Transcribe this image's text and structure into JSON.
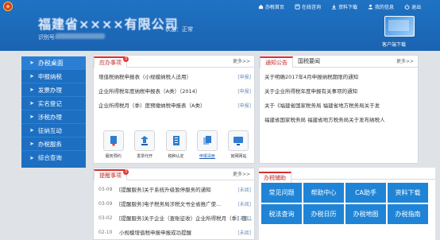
{
  "header": {
    "company_name": "福建省××××有限公司",
    "tax_id_label": "识别号:",
    "status": "状态：正常",
    "nav": [
      {
        "icon": "home-icon",
        "label": "办税首页"
      },
      {
        "icon": "query-icon",
        "label": "在线咨询"
      },
      {
        "icon": "download-icon",
        "label": "资料下载"
      },
      {
        "icon": "user-icon",
        "label": "我的信息"
      },
      {
        "icon": "power-icon",
        "label": "退出"
      }
    ],
    "client_download": "客户端下载"
  },
  "sidebar": {
    "items": [
      {
        "label": "办税桌面"
      },
      {
        "label": "申报纳税"
      },
      {
        "label": "发票办理"
      },
      {
        "label": "实名登记"
      },
      {
        "label": "涉税办理"
      },
      {
        "label": "征纳互动"
      },
      {
        "label": "办税服务"
      },
      {
        "label": "综合查询"
      }
    ]
  },
  "todo": {
    "tab": "应办事项",
    "badge": "3",
    "more": "更多>>",
    "rows": [
      {
        "text": "增值税纳税申报表（小规模纳税人适用）",
        "tag": "[申报]"
      },
      {
        "text": "企业所得税年度纳税申报表（A类）（2014）",
        "tag": "[申报]"
      },
      {
        "text": "企业所得税月（季）度预缴纳税申报表（A类）",
        "tag": "[申报]"
      }
    ],
    "quick": [
      {
        "icon": "tax-record-icon",
        "label": "服务预约"
      },
      {
        "icon": "invoice-purchase-icon",
        "label": "发票代开"
      },
      {
        "icon": "tax-declare-icon",
        "label": "税种认定"
      },
      {
        "icon": "materials-icon",
        "label": "申报清册"
      },
      {
        "icon": "website-icon",
        "label": "官网网站"
      }
    ]
  },
  "notice": {
    "tabs": [
      "通知公告",
      "国税要闻"
    ],
    "more": "更多>>",
    "rows": [
      {
        "text": "关于明确2017年4月申报纳税期限的通知"
      },
      {
        "text": "关于企业所得税年度申报有关事项的通知"
      },
      {
        "text": "关于《福建省国家税务局 福建省地方税务局关于发"
      },
      {
        "text": "福建省国家税务局 福建省地方税务局关于发布纳税人"
      }
    ]
  },
  "reminder": {
    "tab": "提醒事项",
    "badge": "3",
    "more": "更多>>",
    "rows": [
      {
        "date": "03-09",
        "text": "[提醒服务]关于系统升级暂停服务的通知",
        "tag": "[未阅]"
      },
      {
        "date": "03-09",
        "text": "[提醒服务]电子税务局涉税文书全省推广使...",
        "tag": "[未阅]"
      },
      {
        "date": "03-02",
        "text": "[提醒服务]关于企业（查账征收）企业所得税月（季）度...",
        "tag": "[未阅]"
      },
      {
        "date": "02-10",
        "text": "小规模增值税申报申报成功提醒",
        "tag": "[未阅]"
      }
    ]
  },
  "assist": {
    "title": "办税辅助",
    "tiles": [
      "常见问题",
      "帮助中心",
      "CA助手",
      "资料下载",
      "税法查询",
      "办税日历",
      "办税地图",
      "办税指南"
    ]
  }
}
